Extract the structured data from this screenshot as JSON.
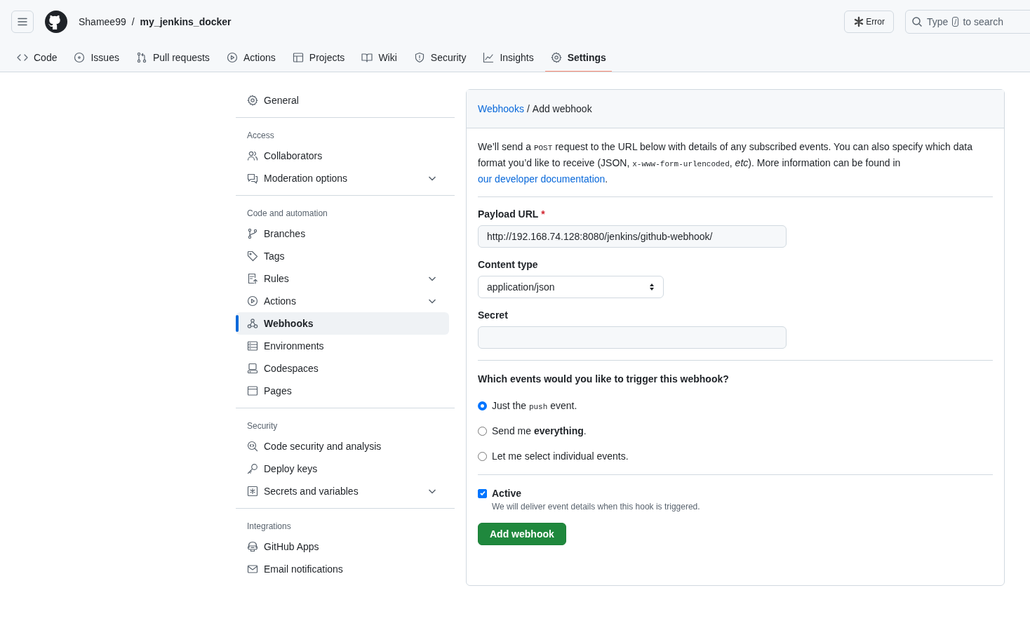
{
  "header": {
    "owner": "Shamee99",
    "separator": "/",
    "repo": "my_jenkins_docker",
    "status_button": "Error",
    "search": [
      "Type",
      "/",
      "to search"
    ]
  },
  "tabs": [
    {
      "label": "Code",
      "selected": false
    },
    {
      "label": "Issues",
      "selected": false
    },
    {
      "label": "Pull requests",
      "selected": false
    },
    {
      "label": "Actions",
      "selected": false
    },
    {
      "label": "Projects",
      "selected": false
    },
    {
      "label": "Wiki",
      "selected": false
    },
    {
      "label": "Security",
      "selected": false
    },
    {
      "label": "Insights",
      "selected": false
    },
    {
      "label": "Settings",
      "selected": true
    }
  ],
  "sidebar": {
    "sections": [
      {
        "items": [
          {
            "label": "General",
            "selected": false,
            "expandable": false
          }
        ]
      },
      {
        "heading": "Access",
        "items": [
          {
            "label": "Collaborators",
            "selected": false,
            "expandable": false
          },
          {
            "label": "Moderation options",
            "selected": false,
            "expandable": true
          }
        ]
      },
      {
        "heading": "Code and automation",
        "items": [
          {
            "label": "Branches",
            "selected": false,
            "expandable": false
          },
          {
            "label": "Tags",
            "selected": false,
            "expandable": false
          },
          {
            "label": "Rules",
            "selected": false,
            "expandable": true
          },
          {
            "label": "Actions",
            "selected": false,
            "expandable": true
          },
          {
            "label": "Webhooks",
            "selected": true,
            "expandable": false
          },
          {
            "label": "Environments",
            "selected": false,
            "expandable": false
          },
          {
            "label": "Codespaces",
            "selected": false,
            "expandable": false
          },
          {
            "label": "Pages",
            "selected": false,
            "expandable": false
          }
        ]
      },
      {
        "heading": "Security",
        "items": [
          {
            "label": "Code security and analysis",
            "selected": false,
            "expandable": false
          },
          {
            "label": "Deploy keys",
            "selected": false,
            "expandable": false
          },
          {
            "label": "Secrets and variables",
            "selected": false,
            "expandable": true
          }
        ]
      },
      {
        "heading": "Integrations",
        "items": [
          {
            "label": "GitHub Apps",
            "selected": false,
            "expandable": false
          },
          {
            "label": "Email notifications",
            "selected": false,
            "expandable": false
          }
        ]
      }
    ]
  },
  "panel": {
    "breadcrumb_link": "Webhooks",
    "breadcrumb_separator": "/",
    "title": "Add webhook",
    "intro": [
      {
        "kind": "text",
        "text": "We’ll send a "
      },
      {
        "kind": "code",
        "text": "POST"
      },
      {
        "kind": "text",
        "text": " request to the URL below with details of any subscribed events. You can also specify which data format you’d like to receive (JSON, "
      },
      {
        "kind": "code",
        "text": "x-www-form-urlencoded"
      },
      {
        "kind": "text",
        "text": ", "
      },
      {
        "kind": "italic",
        "text": "etc"
      },
      {
        "kind": "text",
        "text": "). More information can be found in "
      },
      {
        "kind": "link",
        "text": "our developer documentation"
      },
      {
        "kind": "text",
        "text": "."
      }
    ],
    "payload_url": {
      "label": "Payload URL",
      "required_mark": "*",
      "value": "http://192.168.74.128:8080/jenkins/github-webhook/"
    },
    "content_type": {
      "label": "Content type",
      "value": "application/json"
    },
    "secret": {
      "label": "Secret"
    },
    "events_question": "Which events would you like to trigger this webhook?",
    "events": [
      {
        "selected": true,
        "parts": [
          {
            "kind": "text",
            "text": "Just the "
          },
          {
            "kind": "code",
            "text": "push"
          },
          {
            "kind": "text",
            "text": " event."
          }
        ]
      },
      {
        "selected": false,
        "parts": [
          {
            "kind": "text",
            "text": "Send me "
          },
          {
            "kind": "bold",
            "text": "everything"
          },
          {
            "kind": "text",
            "text": "."
          }
        ]
      },
      {
        "selected": false,
        "parts": [
          {
            "kind": "text",
            "text": "Let me select individual events."
          }
        ]
      }
    ],
    "active": {
      "label": "Active",
      "checked": true,
      "note": "We will deliver event details when this hook is triggered."
    },
    "submit": "Add webhook"
  }
}
